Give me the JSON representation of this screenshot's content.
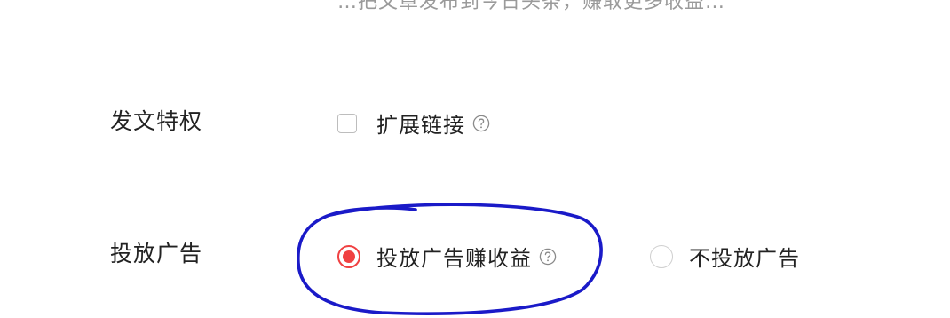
{
  "top_text_partial": "…把文章发布到今日头条，赚取更多收益…",
  "publish_privilege": {
    "label": "发文特权",
    "option_label": "扩展链接",
    "checked": false,
    "help_icon": "question-circle-icon"
  },
  "ad_placement": {
    "label": "投放广告",
    "options": [
      {
        "label": "投放广告赚收益",
        "selected": true,
        "help_icon": "question-circle-icon"
      },
      {
        "label": "不投放广告",
        "selected": false
      }
    ]
  },
  "colors": {
    "accent_red": "#f04142",
    "annotation_blue": "#1a1ac8",
    "muted_text": "#9a9a9a",
    "border_gray": "#bdbdbd"
  }
}
